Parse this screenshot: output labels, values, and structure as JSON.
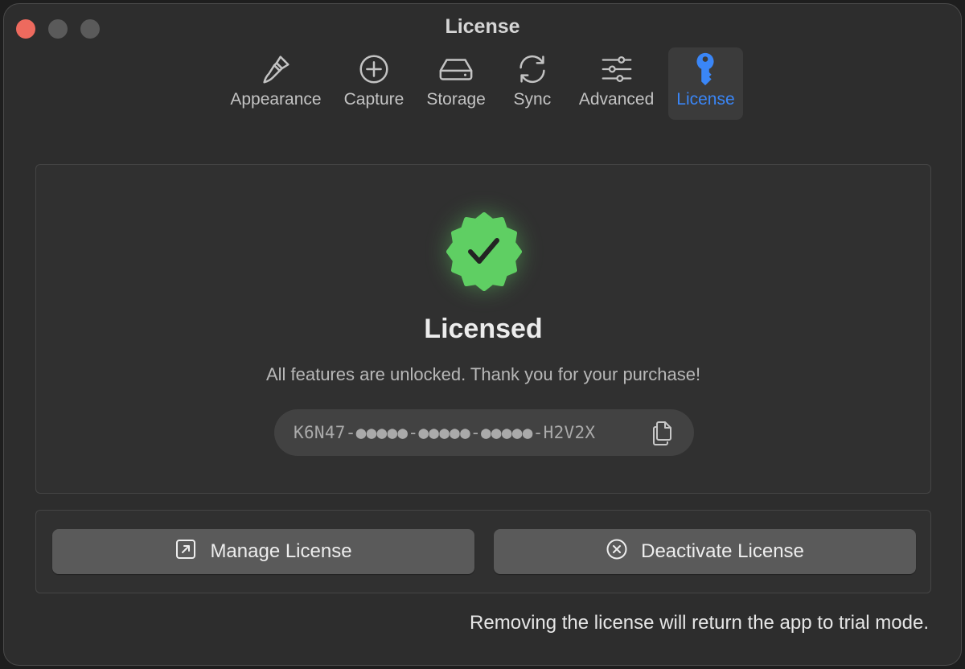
{
  "window": {
    "title": "License"
  },
  "toolbar": {
    "tabs": [
      {
        "label": "Appearance",
        "icon": "paintbrush-icon",
        "active": false
      },
      {
        "label": "Capture",
        "icon": "plus-circle-icon",
        "active": false
      },
      {
        "label": "Storage",
        "icon": "drive-icon",
        "active": false
      },
      {
        "label": "Sync",
        "icon": "sync-arrows-icon",
        "active": false
      },
      {
        "label": "Advanced",
        "icon": "sliders-icon",
        "active": false
      },
      {
        "label": "License",
        "icon": "key-icon",
        "active": true
      }
    ]
  },
  "status": {
    "icon": "verified-checkmark-badge-icon",
    "title": "Licensed",
    "description": "All features are unlocked. Thank you for your purchase!",
    "license_key": "K6N47-●●●●●-●●●●●-●●●●●-H2V2X",
    "copy_icon": "copy-icon"
  },
  "actions": {
    "manage_label": "Manage License",
    "manage_icon": "external-link-square-icon",
    "deactivate_label": "Deactivate License",
    "deactivate_icon": "x-circle-icon"
  },
  "footer": {
    "note": "Removing the license will return the app to trial mode."
  },
  "colors": {
    "accent": "#3a86f7",
    "badge_green": "#5fcf63",
    "window_bg": "#2d2d2d",
    "close_light": "#ed6a5e"
  }
}
